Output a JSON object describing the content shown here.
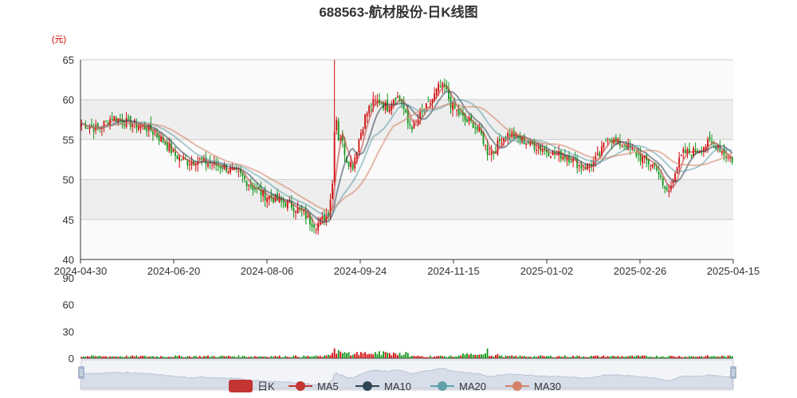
{
  "colors": {
    "up": "#d20a0a",
    "down": "#109618",
    "ma5": "#c23531",
    "ma10": "#2f4554",
    "ma20": "#61a0a8",
    "ma30": "#d48265",
    "grid_band": "#eeeeee",
    "slider_fill": "#d7dde9"
  },
  "chart_data": {
    "type": "candlestick",
    "title": "688563-航材股份-日K线图",
    "y_unit": "(元)",
    "price_axis": {
      "ylim": [
        40,
        65
      ],
      "ticks": [
        40,
        45,
        50,
        55,
        60,
        65
      ]
    },
    "volume_axis": {
      "ylim": [
        0,
        90
      ],
      "ticks": [
        0,
        30,
        60,
        90
      ]
    },
    "x_tick_labels": [
      "2024-04-30",
      "2024-06-20",
      "2024-08-06",
      "2024-09-24",
      "2024-11-15",
      "2025-01-02",
      "2025-02-26",
      "2025-04-15"
    ],
    "legend": [
      "日K",
      "MA5",
      "MA10",
      "MA20",
      "MA30"
    ],
    "legend_placement": "bottom",
    "anchors": [
      [
        0,
        57.0
      ],
      [
        8,
        56.3
      ],
      [
        15,
        57.8
      ],
      [
        22,
        57.2
      ],
      [
        28,
        56.8
      ],
      [
        34,
        56.2
      ],
      [
        40,
        54.8
      ],
      [
        46,
        53.0
      ],
      [
        52,
        52.2
      ],
      [
        58,
        52.4
      ],
      [
        64,
        51.9
      ],
      [
        70,
        51.6
      ],
      [
        78,
        50.5
      ],
      [
        84,
        49.0
      ],
      [
        90,
        48.0
      ],
      [
        96,
        47.4
      ],
      [
        102,
        46.9
      ],
      [
        108,
        46.0
      ],
      [
        112,
        44.8
      ],
      [
        115,
        44.3
      ],
      [
        118,
        45.0
      ],
      [
        121,
        46.0
      ],
      [
        123,
        49.5
      ],
      [
        125,
        55.0
      ],
      [
        127,
        55.5
      ],
      [
        130,
        52.5
      ],
      [
        133,
        51.8
      ],
      [
        136,
        55.0
      ],
      [
        139,
        57.8
      ],
      [
        142,
        59.5
      ],
      [
        146,
        59.8
      ],
      [
        150,
        59.0
      ],
      [
        154,
        60.6
      ],
      [
        157,
        59.7
      ],
      [
        160,
        57.0
      ],
      [
        163,
        56.5
      ],
      [
        166,
        58.0
      ],
      [
        169,
        59.0
      ],
      [
        172,
        60.0
      ],
      [
        175,
        61.5
      ],
      [
        178,
        61.5
      ],
      [
        181,
        59.5
      ],
      [
        184,
        58.5
      ],
      [
        188,
        57.4
      ],
      [
        192,
        57.0
      ],
      [
        196,
        55.5
      ],
      [
        199,
        53.5
      ],
      [
        202,
        53.5
      ],
      [
        206,
        55.2
      ],
      [
        210,
        55.8
      ],
      [
        215,
        55.0
      ],
      [
        220,
        54.5
      ],
      [
        226,
        53.8
      ],
      [
        232,
        53.2
      ],
      [
        238,
        52.9
      ],
      [
        242,
        52.2
      ],
      [
        246,
        51.4
      ],
      [
        250,
        52.0
      ],
      [
        254,
        53.0
      ],
      [
        258,
        55.5
      ],
      [
        262,
        54.6
      ],
      [
        266,
        54.4
      ],
      [
        270,
        53.6
      ],
      [
        274,
        52.8
      ],
      [
        278,
        52.1
      ],
      [
        282,
        51.6
      ],
      [
        285,
        49.0
      ],
      [
        288,
        48.5
      ],
      [
        291,
        51.2
      ],
      [
        295,
        53.3
      ],
      [
        300,
        53.5
      ],
      [
        304,
        54.0
      ],
      [
        308,
        54.6
      ],
      [
        312,
        54.2
      ],
      [
        316,
        53.0
      ],
      [
        319,
        52.5
      ]
    ]
  }
}
